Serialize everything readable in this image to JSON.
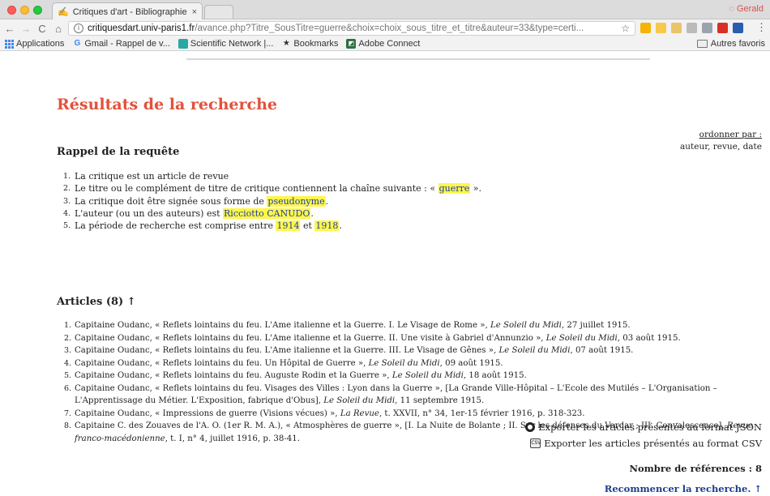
{
  "browser": {
    "tab_title": "Critiques d'art - Bibliographie",
    "profile_name": "Gerald",
    "url_host": "critiquesdart.univ-paris1.fr",
    "url_path": "/avance.php?Titre_SousTitre=guerre&choix=choix_sous_titre_et_titre&auteur=33&type=certi...",
    "bookmarks": [
      {
        "label": "Applications",
        "icon": "apps-grid-icon"
      },
      {
        "label": "Gmail - Rappel de v...",
        "icon": "google-icon"
      },
      {
        "label": "Scientific Network |...",
        "icon": "network-icon"
      },
      {
        "label": "Bookmarks",
        "icon": "star-icon"
      },
      {
        "label": "Adobe Connect",
        "icon": "adobe-icon"
      }
    ],
    "other_bookmarks": "Autres favoris"
  },
  "page": {
    "title": "Résultats de la recherche",
    "order": {
      "label": "ordonner par :",
      "options": "auteur, revue, date"
    },
    "query_heading": "Rappel de la requête",
    "criteria": [
      {
        "n": "1.",
        "before": "La critique est un article de revue",
        "highlight": "",
        "after": ""
      },
      {
        "n": "2.",
        "before": "Le titre ou le complément de titre de critique contiennent la chaîne suivante : « ",
        "highlight": "guerre",
        "after": " »."
      },
      {
        "n": "3.",
        "before": "La critique doit être signée sous forme de ",
        "highlight": "pseudonyme",
        "after": "."
      },
      {
        "n": "4.",
        "before": "L'auteur (ou un des auteurs) est ",
        "highlight": "Ricciotto CANUDO",
        "after": "."
      },
      {
        "n": "5.",
        "before": "La période de recherche est comprise entre ",
        "highlight": "1914",
        "mid": " et ",
        "highlight2": "1918",
        "after": "."
      }
    ],
    "articles_heading": "Articles (8) ↑",
    "articles": [
      {
        "n": "1.",
        "text": "Capitaine Oudanc, « Reflets lointains du feu. L'Ame italienne et la Guerre. I. Le Visage de Rome », ",
        "journal": "Le Soleil du Midi",
        "tail": ", 27 juillet 1915."
      },
      {
        "n": "2.",
        "text": "Capitaine Oudanc, « Reflets lointains du feu. L'Ame italienne et la Guerre. II. Une visite à Gabriel d'Annunzio », ",
        "journal": "Le Soleil du Midi",
        "tail": ", 03 août 1915."
      },
      {
        "n": "3.",
        "text": "Capitaine Oudanc, « Reflets lointains du feu. L'Ame italienne et la Guerre. III. Le Visage de Gênes », ",
        "journal": "Le Soleil du Midi",
        "tail": ", 07 août 1915."
      },
      {
        "n": "4.",
        "text": "Capitaine Oudanc, « Reflets lointains du feu. Un Hôpital de Guerre », ",
        "journal": "Le Soleil du Midi",
        "tail": ", 09 août 1915."
      },
      {
        "n": "5.",
        "text": "Capitaine Oudanc, « Reflets lointains du feu. Auguste Rodin et la Guerre », ",
        "journal": "Le Soleil du Midi",
        "tail": ", 18 août 1915."
      },
      {
        "n": "6.",
        "text": "Capitaine Oudanc, « Reflets lointains du feu. Visages des Villes : Lyon dans la Guerre », [La Grande Ville-Hôpital – L'Ecole des Mutilés – L'Organisation – L'Apprentissage du Métier. L'Exposition, fabrique d'Obus], ",
        "journal": "Le Soleil du Midi",
        "tail": ", 11 septembre 1915."
      },
      {
        "n": "7.",
        "text": "Capitaine Oudanc, « Impressions de guerre (Visions vécues) », ",
        "journal": "La Revue",
        "tail": ", t. XXVII, n° 34, 1er-15 février 1916, p. 318-323."
      },
      {
        "n": "8.",
        "text": "Capitaine C. des Zouaves de l'A. O. (1er R. M. A.), « Atmosphères de guerre », [I. La Nuite de Bolante ; II. Sur les défenses du Vardar ; III. Convalescence], ",
        "journal": "Revue franco-macédonienne",
        "tail": ", t. I, n° 4, juillet 1916, p. 38-41."
      }
    ],
    "export_json": "Exporter les articles présentés au format JSON",
    "export_csv": "Exporter les articles présentés au format CSV",
    "count": "Nombre de références : 8",
    "restart": "Recommencer la recherche. ↑"
  }
}
